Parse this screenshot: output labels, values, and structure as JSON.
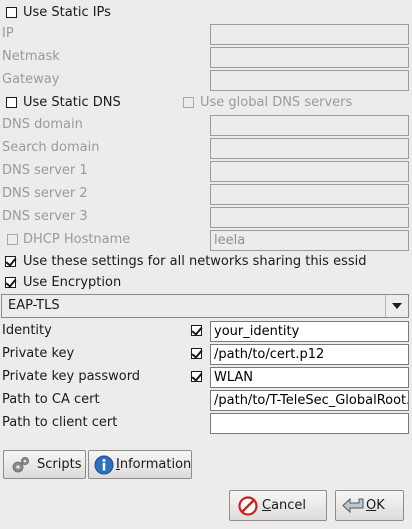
{
  "static_ips": {
    "label": "Use Static IPs",
    "checked": false
  },
  "ip_fields": [
    {
      "label": "IP",
      "value": ""
    },
    {
      "label": "Netmask",
      "value": ""
    },
    {
      "label": "Gateway",
      "value": ""
    }
  ],
  "static_dns": {
    "label": "Use Static DNS",
    "checked": false
  },
  "global_dns": {
    "label": "Use global DNS servers",
    "checked": false
  },
  "dns_fields": [
    {
      "label": "DNS domain",
      "value": ""
    },
    {
      "label": "Search domain",
      "value": ""
    },
    {
      "label": "DNS server 1",
      "value": ""
    },
    {
      "label": "DNS server 2",
      "value": ""
    },
    {
      "label": "DNS server 3",
      "value": ""
    }
  ],
  "dhcp_hostname": {
    "label": "DHCP Hostname",
    "checked": false,
    "value": "leela"
  },
  "share_settings": {
    "label": "Use these settings for all networks sharing this essid",
    "checked": true
  },
  "encryption": {
    "label": "Use Encryption",
    "checked": true
  },
  "encryption_type": {
    "selected": "EAP-TLS"
  },
  "enc_fields": [
    {
      "label": "Identity",
      "checked": true,
      "value": "your_identity"
    },
    {
      "label": "Private key",
      "checked": true,
      "value": "/path/to/cert.p12"
    },
    {
      "label": "Private key password",
      "checked": true,
      "value": "WLAN"
    },
    {
      "label": "Path to CA cert",
      "value": "/path/to/T-TeleSec_GlobalRoot..."
    },
    {
      "label": "Path to client cert",
      "value": ""
    }
  ],
  "buttons": {
    "scripts": "Scripts",
    "information_mnemonic": "I",
    "information_rest": "nformation",
    "cancel_mnemonic": "C",
    "cancel_rest": "ancel",
    "ok_mnemonic": "O",
    "ok_rest": "K"
  },
  "icons": {
    "scripts": "gear-icon",
    "information": "info-icon",
    "cancel": "cancel-icon",
    "ok": "ok-arrow-icon"
  },
  "colors": {
    "background": "#edeceb",
    "disabled_text": "#9a9a9a",
    "info_blue": "#2f6fc0",
    "cancel_red": "#cc1f1f"
  }
}
